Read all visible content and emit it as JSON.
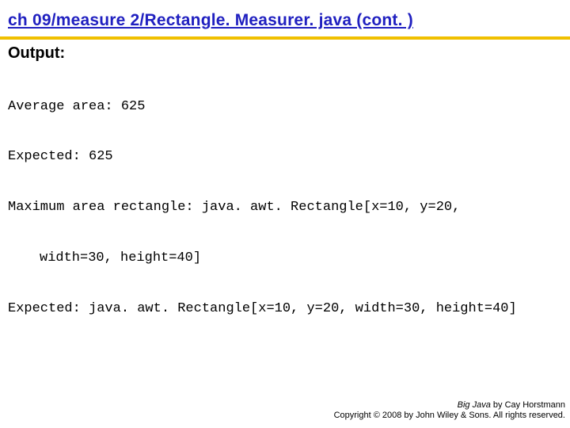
{
  "title": "ch 09/measure 2/Rectangle. Measurer. java  (cont. )",
  "output_label": "Output:",
  "code": {
    "line1": "Average area: 625",
    "line2": "Expected: 625",
    "line3": "Maximum area rectangle: java. awt. Rectangle[x=10, y=20,",
    "line4": "width=30, height=40]",
    "line5": "Expected: java. awt. Rectangle[x=10, y=20, width=30, height=40]"
  },
  "footer": {
    "book": "Big Java",
    "by": " by Cay Horstmann",
    "copyright": "Copyright © 2008 by John Wiley & Sons.  All rights reserved."
  }
}
